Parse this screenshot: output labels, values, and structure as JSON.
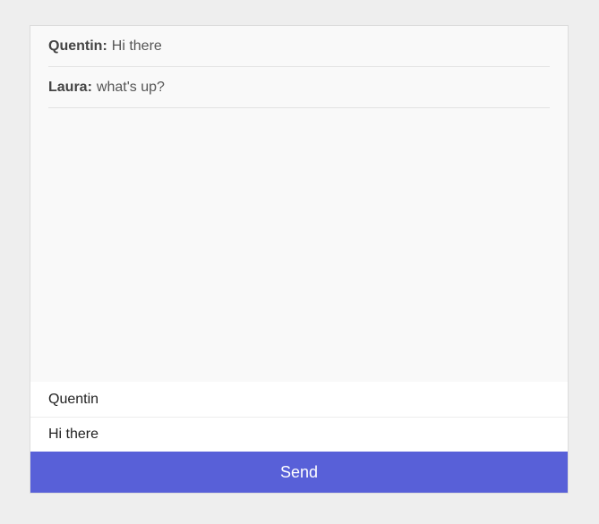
{
  "messages": [
    {
      "author": "Quentin:",
      "text": "Hi there"
    },
    {
      "author": "Laura:",
      "text": "what's up?"
    }
  ],
  "form": {
    "name_value": "Quentin",
    "message_value": "Hi there",
    "send_label": "Send"
  },
  "colors": {
    "send_button": "#5860d8",
    "page_background": "#eeeeee",
    "chat_background": "#f9f9f9"
  }
}
